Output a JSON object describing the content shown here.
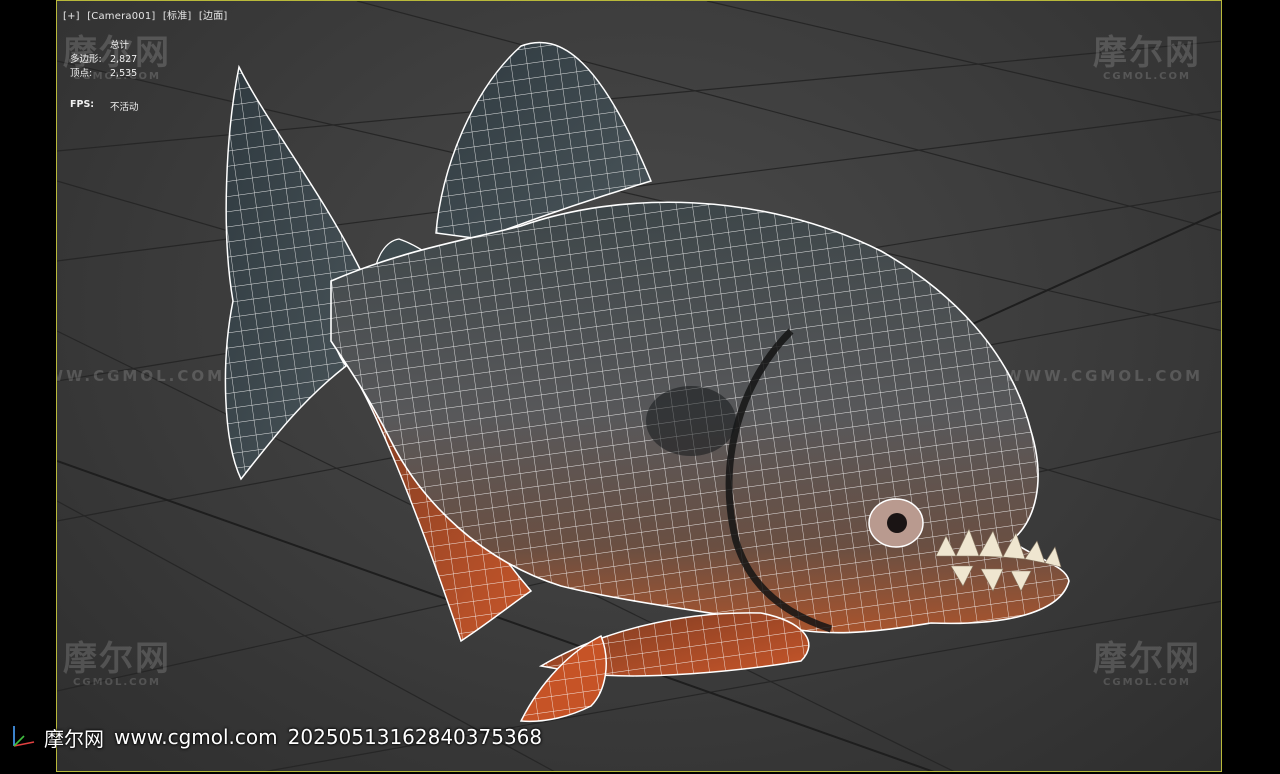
{
  "viewport": {
    "label_items": [
      "[+]",
      "[Camera001]",
      "[标准]",
      "[边面]"
    ],
    "border_color": "#b9b93a"
  },
  "stats": {
    "title": "总计",
    "polygons_label": "多边形:",
    "polygons_value": "2,827",
    "vertices_label": "顶点:",
    "vertices_value": "2,535",
    "fps_label": "FPS:",
    "fps_value": "不活动"
  },
  "watermarks": {
    "site_text": "WWW.CGMOL.COM",
    "logo_cn": "摩尔网",
    "logo_en": "CGMOL.COM"
  },
  "footer": {
    "brand": "摩尔网",
    "url": "www.cgmol.com",
    "id": "20250513162840375368"
  },
  "model": {
    "subject": "piranha",
    "wire_color": "#ffffff",
    "body_color": "#4c5557",
    "belly_color": "#b5532a"
  }
}
